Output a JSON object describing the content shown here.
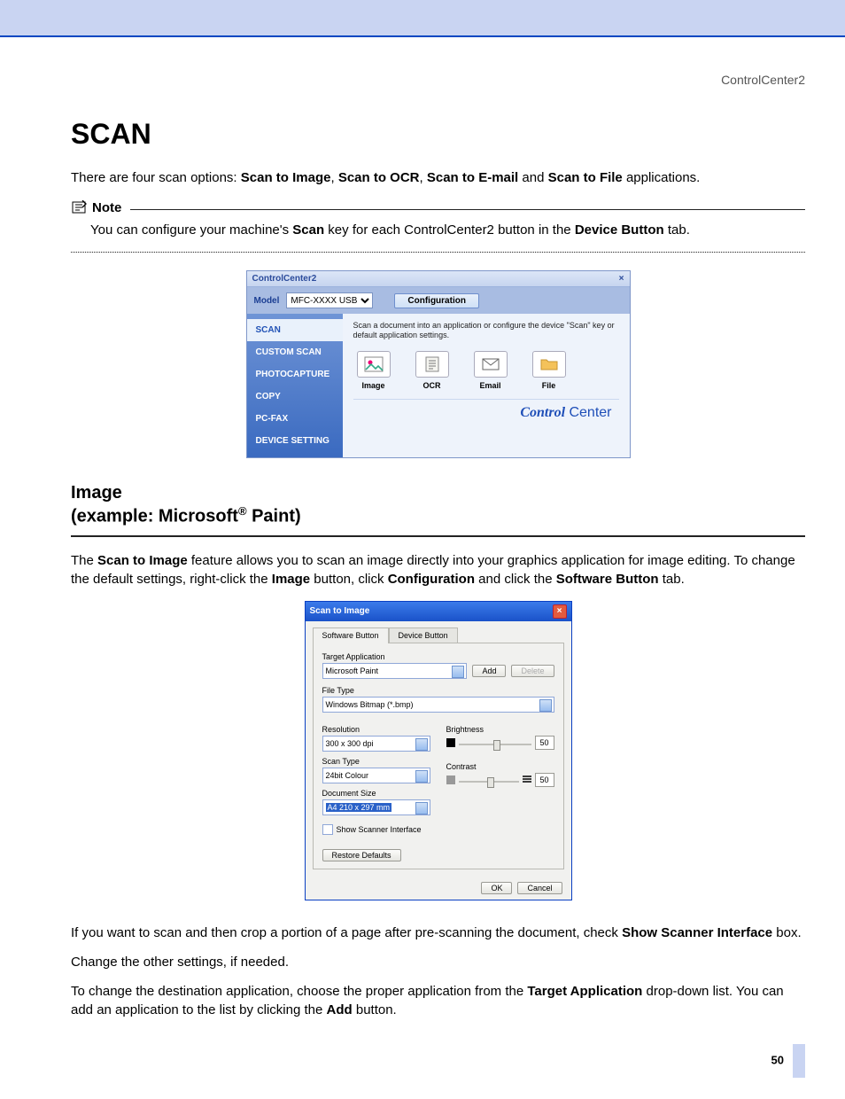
{
  "header": {
    "section": "ControlCenter2"
  },
  "title": "SCAN",
  "intro": {
    "pre": "There are four scan options: ",
    "o1": "Scan to Image",
    "s1": ", ",
    "o2": "Scan to OCR",
    "s2": ", ",
    "o3": "Scan to E-mail",
    "s3": " and ",
    "o4": "Scan to File",
    "post": " applications."
  },
  "note": {
    "label": "Note",
    "t1": "You can configure your machine's ",
    "b1": "Scan",
    "t2": " key for each ControlCenter2 button in the ",
    "b2": "Device Button",
    "t3": " tab."
  },
  "cc": {
    "title": "ControlCenter2",
    "close": "×",
    "model_lbl": "Model",
    "model_val": "MFC-XXXX USB",
    "config_btn": "Configuration",
    "side": {
      "scan": "SCAN",
      "custom": "CUSTOM SCAN",
      "photo": "PHOTOCAPTURE",
      "copy": "COPY",
      "pcfax": "PC-FAX",
      "device": "DEVICE SETTING"
    },
    "desc": "Scan a document into an application or configure the device \"Scan\" key or default application settings.",
    "icons": {
      "image": "Image",
      "ocr": "OCR",
      "email": "Email",
      "file": "File"
    },
    "brand1": "Control",
    "brand2": " Center"
  },
  "h2": {
    "l1": "Image",
    "l2_a": " (example: Microsoft",
    "l2_b": " Paint)"
  },
  "p2": {
    "t1": "The ",
    "b1": "Scan to Image",
    "t2": " feature allows you to scan an image directly into your graphics application for image editing. To change the default settings, right-click the ",
    "b2": "Image",
    "t3": " button, click ",
    "b3": "Configuration",
    "t4": " and click the ",
    "b4": "Software Button",
    "t5": " tab."
  },
  "dlg": {
    "title": "Scan to Image",
    "close": "×",
    "tab1": "Software Button",
    "tab2": "Device Button",
    "target_lbl": "Target Application",
    "target_val": "Microsoft Paint",
    "add": "Add",
    "delete": "Delete",
    "filetype_lbl": "File Type",
    "filetype_val": "Windows Bitmap (*.bmp)",
    "res_lbl": "Resolution",
    "res_val": "300 x 300 dpi",
    "scantype_lbl": "Scan Type",
    "scantype_val": "24bit Colour",
    "docsize_lbl": "Document Size",
    "docsize_val": "A4 210 x 297 mm",
    "bright_lbl": "Brightness",
    "bright_val": "50",
    "contrast_lbl": "Contrast",
    "contrast_val": "50",
    "show_scanner": "Show Scanner Interface",
    "restore": "Restore Defaults",
    "ok": "OK",
    "cancel": "Cancel"
  },
  "p3": {
    "t1": "If you want to scan and then crop a portion of a page after pre-scanning the document, check ",
    "b1": "Show Scanner Interface",
    "t2": " box."
  },
  "p4": "Change the other settings, if needed.",
  "p5": {
    "t1": "To change the destination application, choose the proper application from the ",
    "b1": "Target Application",
    "t2": " drop-down list. You can add an application to the list by clicking the ",
    "b2": "Add",
    "t3": " button."
  },
  "page_num": "50"
}
